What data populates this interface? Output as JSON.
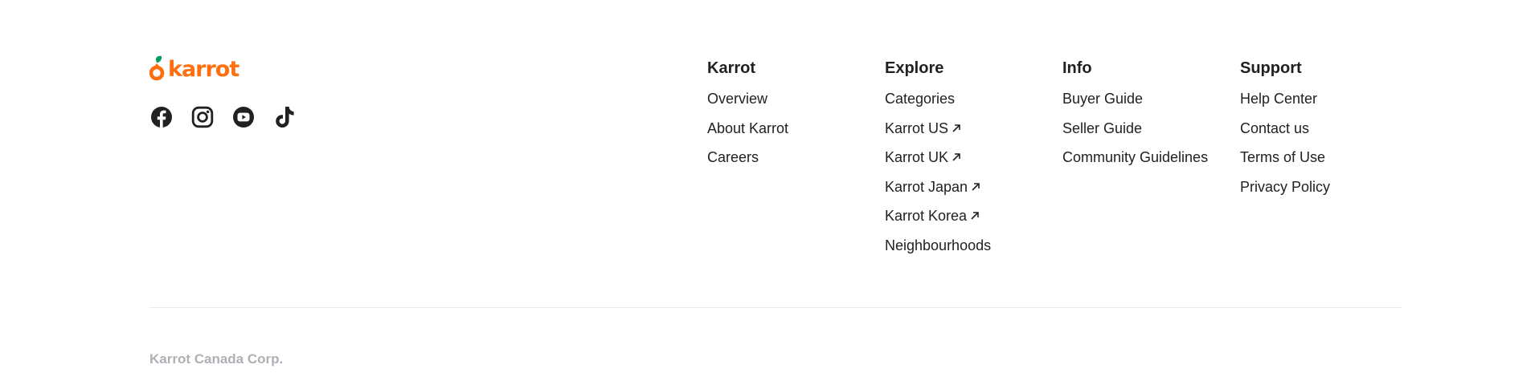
{
  "brand": {
    "logo_text": "karrot",
    "colors": {
      "primary": "#ff6f0f",
      "leaf": "#00a05b"
    }
  },
  "social": [
    {
      "icon": "facebook-icon"
    },
    {
      "icon": "instagram-icon"
    },
    {
      "icon": "youtube-icon"
    },
    {
      "icon": "tiktok-icon"
    }
  ],
  "columns": {
    "karrot": {
      "title": "Karrot",
      "links": [
        "Overview",
        "About Karrot",
        "Careers"
      ]
    },
    "explore": {
      "title": "Explore",
      "links": [
        "Categories",
        "Karrot US",
        "Karrot UK",
        "Karrot Japan",
        "Karrot Korea",
        "Neighbourhoods"
      ]
    },
    "info": {
      "title": "Info",
      "links": [
        "Buyer Guide",
        "Seller Guide",
        "Community Guidelines"
      ]
    },
    "support": {
      "title": "Support",
      "links": [
        "Help Center",
        "Contact us",
        "Terms of Use",
        "Privacy Policy"
      ]
    }
  },
  "copyright": "Karrot Canada Corp."
}
